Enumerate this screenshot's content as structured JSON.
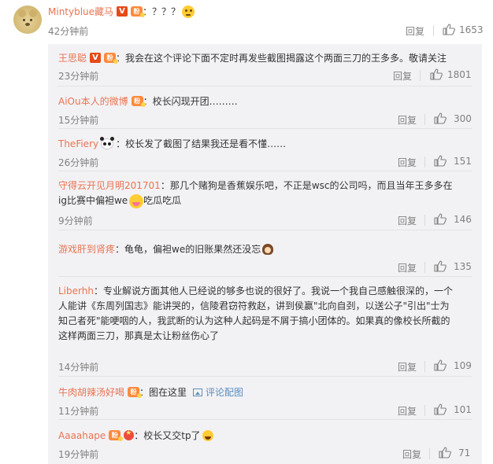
{
  "main": {
    "username": "Mintyblue藏马",
    "text": "：？？？",
    "time": "42分钟前",
    "reply": "回复",
    "likes": "1653"
  },
  "subs": [
    {
      "username": "王思聪",
      "text": "：我会在这个评论下面不定时再发些截图揭露这个两面三刀的王多多。敬请关注",
      "time": "23分钟前",
      "reply": "回复",
      "likes": "1801"
    },
    {
      "username": "AiOu本人的微博",
      "text": "：校长闪现开团………",
      "time": "15分钟前",
      "reply": "回复",
      "likes": "300"
    },
    {
      "username": "TheFiery",
      "text": "：校长发了截图了结果我还是看不懂……",
      "time": "26分钟前",
      "reply": "回复",
      "likes": "151"
    },
    {
      "username": "守得云开见月明201701",
      "text_a": "：那几个赌狗是香蕉娱乐吧，不正是wsc的公司吗，而且当年王多多在",
      "text_b": "ig比赛中偏袒we",
      "text_c": "吃瓜吃瓜",
      "time": "9分钟前",
      "reply": "回复",
      "likes": "146"
    },
    {
      "username": "游戏肝到肾疼",
      "text": "：龟龟，偏袒we的旧账果然还没忘",
      "time": "",
      "reply": "回复",
      "likes": "135"
    },
    {
      "username": "Liberhh",
      "text_a": "：专业解说方面其他人已经说的够多也说的很好了。我说一个我自己感触很深的，一个",
      "text_b": "人能讲《东周列国志》能讲哭的，信陵君窃符救赵，讲到侯赢\"北向自刭，以送公子\"引出\"士为",
      "text_c": "知己者死\"能哽咽的人，我武断的认为这种人起码是不屑于搞小团体的。如果真的像校长所截的",
      "text_d": "这样两面三刀，那真是太让粉丝伤心了",
      "time": "14分钟前",
      "reply": "回复",
      "likes": "109"
    },
    {
      "username": "牛肉胡辣汤好喝",
      "text": "：图在这里",
      "pic_link": "评论配图",
      "time": "11分钟前",
      "reply": "回复",
      "likes": "101"
    },
    {
      "username": "Aaaahape",
      "text": "：校长又交tp了",
      "time": "19分钟前",
      "reply": "回复",
      "likes": "71"
    }
  ]
}
